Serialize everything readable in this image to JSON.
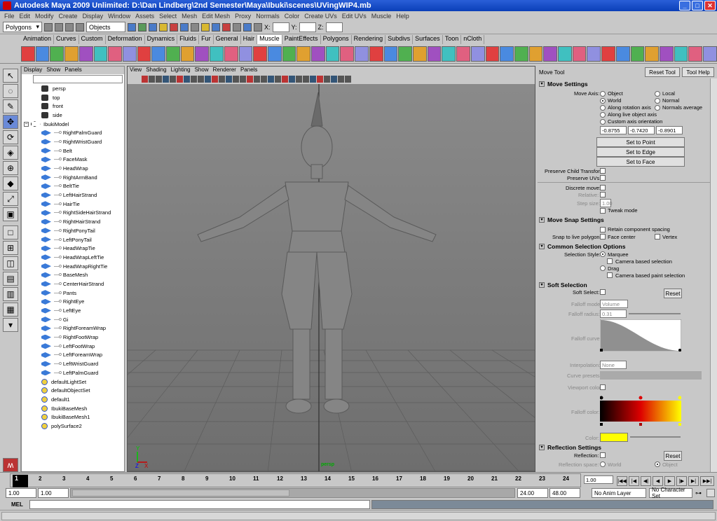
{
  "window": {
    "title": "Autodesk Maya 2009 Unlimited: D:\\Dan Lindberg\\2nd Semester\\Maya\\Ibuki\\scenes\\UVingWIP4.mb",
    "minimize": "_",
    "maximize": "□",
    "close": "✕"
  },
  "menubar": [
    "File",
    "Edit",
    "Modify",
    "Create",
    "Display",
    "Window",
    "Assets",
    "Select",
    "Mesh",
    "Edit Mesh",
    "Proxy",
    "Normals",
    "Color",
    "Create UVs",
    "Edit UVs",
    "Muscle",
    "Help"
  ],
  "statusline": {
    "mode": "Polygons",
    "selection_mode": "Objects",
    "x_label": "X:",
    "y_label": "Y:",
    "z_label": "Z:"
  },
  "shelf_tabs": [
    "Animation",
    "Curves",
    "Custom",
    "Deformation",
    "Dynamics",
    "Fluids",
    "Fur",
    "General",
    "Hair",
    "Muscle",
    "PaintEffects",
    "Polygons",
    "Rendering",
    "Subdivs",
    "Surfaces",
    "Toon",
    "nCloth"
  ],
  "shelf_active_tab": "Muscle",
  "outliner": {
    "menu": [
      "Display",
      "Show",
      "Panels"
    ],
    "items": [
      {
        "label": "persp",
        "type": "camera",
        "indent": 0
      },
      {
        "label": "top",
        "type": "camera",
        "indent": 0
      },
      {
        "label": "front",
        "type": "camera",
        "indent": 0
      },
      {
        "label": "side",
        "type": "camera",
        "indent": 0
      },
      {
        "label": "IbukiModel",
        "type": "group",
        "indent": 0
      },
      {
        "label": "RightPalmGuard",
        "type": "mesh",
        "indent": 1
      },
      {
        "label": "RightWristGuard",
        "type": "mesh",
        "indent": 1
      },
      {
        "label": "Belt",
        "type": "mesh",
        "indent": 1
      },
      {
        "label": "FaceMask",
        "type": "mesh",
        "indent": 1
      },
      {
        "label": "HeadWrap",
        "type": "mesh",
        "indent": 1
      },
      {
        "label": "RightArmBand",
        "type": "mesh",
        "indent": 1
      },
      {
        "label": "BeltTie",
        "type": "mesh",
        "indent": 1
      },
      {
        "label": "LeftHairStrand",
        "type": "mesh",
        "indent": 1
      },
      {
        "label": "HairTie",
        "type": "mesh",
        "indent": 1
      },
      {
        "label": "RightSideHairStrand",
        "type": "mesh",
        "indent": 1
      },
      {
        "label": "RightHairStrand",
        "type": "mesh",
        "indent": 1
      },
      {
        "label": "RightPonyTail",
        "type": "mesh",
        "indent": 1
      },
      {
        "label": "LeftPonyTail",
        "type": "mesh",
        "indent": 1
      },
      {
        "label": "HeadWrapTie",
        "type": "mesh",
        "indent": 1
      },
      {
        "label": "HeadWrapLeftTie",
        "type": "mesh",
        "indent": 1
      },
      {
        "label": "HeadWrapRightTie",
        "type": "mesh",
        "indent": 1
      },
      {
        "label": "BaseMesh",
        "type": "mesh",
        "indent": 1
      },
      {
        "label": "CenterHairStrand",
        "type": "mesh",
        "indent": 1
      },
      {
        "label": "Pants",
        "type": "mesh",
        "indent": 1
      },
      {
        "label": "RightEye",
        "type": "mesh",
        "indent": 1
      },
      {
        "label": "LeftEye",
        "type": "mesh",
        "indent": 1
      },
      {
        "label": "Gi",
        "type": "mesh",
        "indent": 1
      },
      {
        "label": "RightForeamWrap",
        "type": "mesh",
        "indent": 1
      },
      {
        "label": "RightFootWrap",
        "type": "mesh",
        "indent": 1
      },
      {
        "label": "LeftFootWrap",
        "type": "mesh",
        "indent": 1
      },
      {
        "label": "LeftForeamWrap",
        "type": "mesh",
        "indent": 1
      },
      {
        "label": "LeftWristGuard",
        "type": "mesh",
        "indent": 1
      },
      {
        "label": "LeftPalmGuard",
        "type": "mesh",
        "indent": 1
      },
      {
        "label": "defaultLightSet",
        "type": "set",
        "indent": 0
      },
      {
        "label": "defaultObjectSet",
        "type": "set",
        "indent": 0
      },
      {
        "label": "default1",
        "type": "set",
        "indent": 0
      },
      {
        "label": "IbukiBaseMesh",
        "type": "set",
        "indent": 0
      },
      {
        "label": "IbukiBaseMesh1",
        "type": "set",
        "indent": 0
      },
      {
        "label": "polySurface2",
        "type": "set",
        "indent": 0
      }
    ]
  },
  "viewport": {
    "menu": [
      "View",
      "Shading",
      "Lighting",
      "Show",
      "Renderer",
      "Panels"
    ],
    "hud": [
      {
        "k": "Verts:",
        "a": "30726",
        "b": "0",
        "c": "0"
      },
      {
        "k": "Edges:",
        "a": "61210",
        "b": "0",
        "c": "0"
      },
      {
        "k": "Faces:",
        "a": "30502",
        "b": "0",
        "c": "0"
      },
      {
        "k": "Tris:",
        "a": "60154",
        "b": "0",
        "c": "0"
      },
      {
        "k": "UVs:",
        "a": "29663",
        "b": "0",
        "c": "0"
      }
    ],
    "camera": "persp",
    "axis_y": "Y",
    "axis_z": "Z",
    "axis_x": "X"
  },
  "tool_settings": {
    "title": "Move Tool",
    "reset_tool": "Reset Tool",
    "tool_help": "Tool Help",
    "move_settings": "Move Settings",
    "move_axis": "Move Axis:",
    "axis_object": "Object",
    "axis_local": "Local",
    "axis_world": "World",
    "axis_normal": "Normal",
    "axis_rotation": "Along rotation axis",
    "axis_normals_avg": "Normals average",
    "axis_live": "Along live object axis",
    "axis_custom": "Custom axis orientation",
    "v1": "-0.8755",
    "v2": "-0.7420",
    "v3": "-0.8901",
    "set_to_point": "Set to Point",
    "set_to_edge": "Set to Edge",
    "set_to_face": "Set to Face",
    "preserve_child": "Preserve Child Transform",
    "preserve_uvs": "Preserve UVs",
    "discrete_move": "Discrete move:",
    "relative": "Relative:",
    "step_size": "Step size:",
    "step_val": "1.00",
    "tweak_mode": "Tweak mode",
    "snap_settings": "Move Snap Settings",
    "retain_spacing": "Retain component spacing",
    "snap_live": "Snap to live polygon:",
    "face_center": "Face center",
    "vertex": "Vertex",
    "common_sel": "Common Selection Options",
    "sel_style": "Selection Style:",
    "marquee": "Marquee",
    "camera_based_sel": "Camera based selection",
    "drag": "Drag",
    "camera_paint_sel": "Camera based paint selection",
    "soft_sel": "Soft Selection",
    "soft_select": "Soft Select:",
    "reset": "Reset",
    "falloff_mode": "Falloff mode:",
    "falloff_mode_val": "Volume",
    "falloff_radius": "Falloff radius:",
    "falloff_radius_val": "0.31",
    "falloff_curve": "Falloff curve:",
    "interpolation": "Interpolation:",
    "interp_val": "None",
    "curve_presets": "Curve presets:",
    "viewport_color": "Viewport color:",
    "falloff_color": "Falloff color:",
    "color": "Color:",
    "reflection": "Reflection Settings",
    "reflection_lbl": "Reflection:",
    "reflection_reset": "Reset",
    "reflection_space": "Reflection space:",
    "refl_world": "World",
    "refl_object": "Object"
  },
  "timeline": {
    "current_frame": "1",
    "ticks": [
      "2",
      "3",
      "4",
      "5",
      "6",
      "7",
      "8",
      "9",
      "10",
      "11",
      "12",
      "13",
      "14",
      "15",
      "16",
      "17",
      "18",
      "19",
      "20",
      "21",
      "22",
      "23",
      "24"
    ],
    "frame_field": "1.00"
  },
  "range": {
    "start": "1.00",
    "inner_start": "1.00",
    "inner_end": "24.00",
    "end": "48.00",
    "anim_layer": "No Anim Layer",
    "char_set": "No Character Set"
  },
  "cmdline": {
    "mel": "MEL"
  },
  "colors": {
    "viewport_bg": "#7a7a7a",
    "title_bar": "#0a3fb8",
    "soft_color": "#ffff00"
  }
}
